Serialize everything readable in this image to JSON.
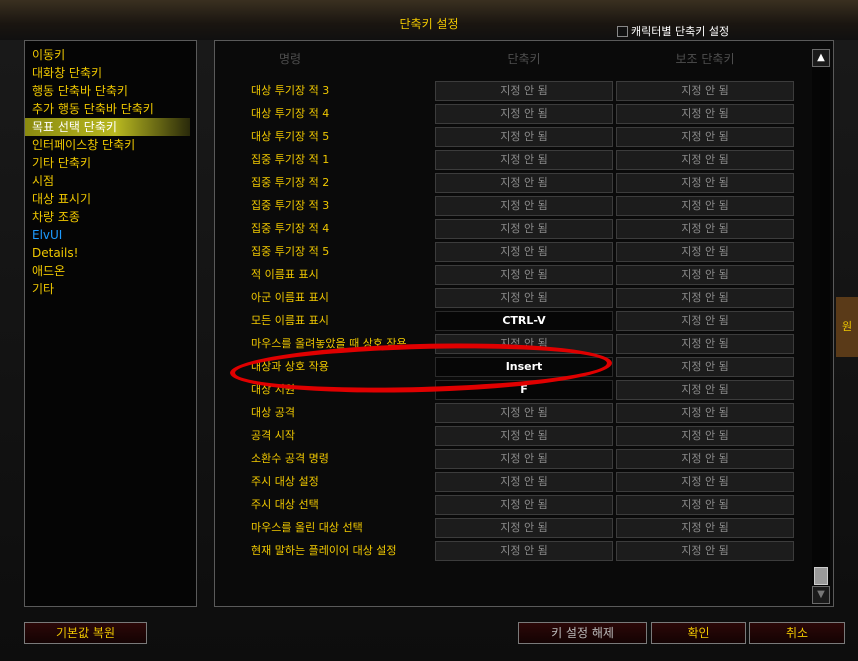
{
  "window": {
    "title": "단축키 설정",
    "char_specific_label": "캐릭터별 단축키 설정",
    "char_specific_checked": false
  },
  "categories": [
    {
      "label": "이동키"
    },
    {
      "label": "대화창 단축키"
    },
    {
      "label": "행동 단축바 단축키"
    },
    {
      "label": "추가 행동 단축바 단축키"
    },
    {
      "label": "목표 선택 단축키",
      "selected": true
    },
    {
      "label": "인터페이스창 단축키"
    },
    {
      "label": "기타 단축키"
    },
    {
      "label": "시점"
    },
    {
      "label": "대상 표시기"
    },
    {
      "label": "차량 조종"
    },
    {
      "label": "ElvUI"
    },
    {
      "label": "Details!"
    },
    {
      "label": "애드온"
    },
    {
      "label": "기타"
    }
  ],
  "columns": {
    "command": "명령",
    "key1": "단축키",
    "key2": "보조 단축키"
  },
  "rows": [
    {
      "name": "대상 투기장 적 3",
      "key1": "지정 안 됨",
      "key2": "지정 안 됨"
    },
    {
      "name": "대상 투기장 적 4",
      "key1": "지정 안 됨",
      "key2": "지정 안 됨"
    },
    {
      "name": "대상 투기장 적 5",
      "key1": "지정 안 됨",
      "key2": "지정 안 됨"
    },
    {
      "name": "집중 투기장 적 1",
      "key1": "지정 안 됨",
      "key2": "지정 안 됨"
    },
    {
      "name": "집중 투기장 적 2",
      "key1": "지정 안 됨",
      "key2": "지정 안 됨"
    },
    {
      "name": "집중 투기장 적 3",
      "key1": "지정 안 됨",
      "key2": "지정 안 됨"
    },
    {
      "name": "집중 투기장 적 4",
      "key1": "지정 안 됨",
      "key2": "지정 안 됨"
    },
    {
      "name": "집중 투기장 적 5",
      "key1": "지정 안 됨",
      "key2": "지정 안 됨"
    },
    {
      "name": "적 이름표 표시",
      "key1": "지정 안 됨",
      "key2": "지정 안 됨"
    },
    {
      "name": "아군 이름표 표시",
      "key1": "지정 안 됨",
      "key2": "지정 안 됨"
    },
    {
      "name": "모든 이름표 표시",
      "key1": "CTRL-V",
      "key1_set": true,
      "key2": "지정 안 됨"
    },
    {
      "name": "마우스를 올려놓았을 때 상호 작용",
      "key1": "지정 안 됨",
      "key2": "지정 안 됨"
    },
    {
      "name": "대상과 상호 작용",
      "key1": "Insert",
      "key1_set": true,
      "key2": "지정 안 됨"
    },
    {
      "name": "대상 지원",
      "key1": "F",
      "key1_set": true,
      "key2": "지정 안 됨"
    },
    {
      "name": "대상 공격",
      "key1": "지정 안 됨",
      "key2": "지정 안 됨"
    },
    {
      "name": "공격 시작",
      "key1": "지정 안 됨",
      "key2": "지정 안 됨"
    },
    {
      "name": "소환수 공격 명령",
      "key1": "지정 안 됨",
      "key2": "지정 안 됨"
    },
    {
      "name": "주시 대상 설정",
      "key1": "지정 안 됨",
      "key2": "지정 안 됨"
    },
    {
      "name": "주시 대상 선택",
      "key1": "지정 안 됨",
      "key2": "지정 안 됨"
    },
    {
      "name": "마우스를 올린 대상 선택",
      "key1": "지정 안 됨",
      "key2": "지정 안 됨"
    },
    {
      "name": "현재 말하는 플레이어 대상 설정",
      "key1": "지정 안 됨",
      "key2": "지정 안 됨"
    }
  ],
  "buttons": {
    "reset_default": "기본값 복원",
    "unbind_key": "키 설정 해제",
    "confirm": "확인",
    "cancel": "취소"
  },
  "background_side_text": "원",
  "scrollbar": {
    "up_icon": "▲",
    "down_icon": "▼"
  },
  "colors": {
    "label_yellow": "#f0c800",
    "elvui_blue": "#1e9bff",
    "highlight_red": "#e00000"
  }
}
